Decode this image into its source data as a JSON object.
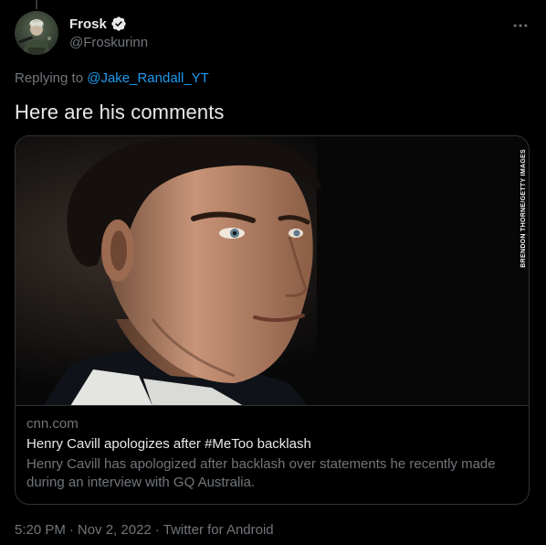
{
  "tweet": {
    "author": {
      "display_name": "Frosk",
      "handle": "@Froskurinn",
      "verified": true,
      "avatar_icon": "avatar-image"
    },
    "more_icon": "more-horizontal-icon",
    "reply": {
      "prefix": "Replying to",
      "handle": "@Jake_Randall_YT"
    },
    "text": "Here are his comments",
    "card": {
      "image_icon": "article-photo",
      "photo_credit": "BRENDON THORNE/GETTY IMAGES",
      "domain": "cnn.com",
      "title": "Henry Cavill apologizes after #MeToo backlash",
      "description": "Henry Cavill has apologized after backlash over statements he recently made during an interview with GQ Australia."
    },
    "meta": {
      "time": "5:20 PM",
      "separator": "·",
      "date": "Nov 2, 2022",
      "client": "Twitter for Android"
    }
  },
  "colors": {
    "background": "#000000",
    "text_primary": "#e7e9ea",
    "text_secondary": "#71767b",
    "link": "#1d9bf0",
    "border": "#2f3336"
  }
}
